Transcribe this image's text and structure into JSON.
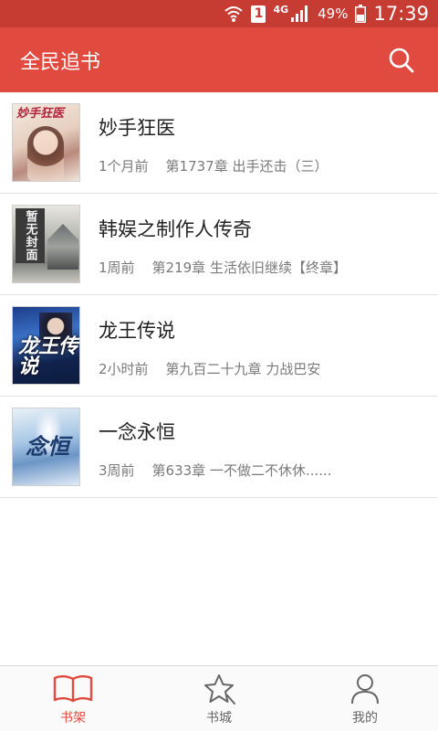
{
  "status_bar": {
    "network_type": "4G",
    "sim_label": "1",
    "battery": "49%",
    "time": "17:39",
    "icons": [
      "wifi-icon",
      "sim-icon",
      "signal-icon",
      "battery-icon"
    ]
  },
  "app_bar": {
    "title": "全民追书",
    "search_icon": "search-icon"
  },
  "books": [
    {
      "title": "妙手狂医",
      "time": "1个月前",
      "chapter": "第1737章 出手还击（三）",
      "cover_text": "妙手狂医"
    },
    {
      "title": "韩娱之制作人传奇",
      "time": "1周前",
      "chapter": "第219章 生活依旧继续【终章】",
      "cover_text": "暂无封面"
    },
    {
      "title": "龙王传说",
      "time": "2小时前",
      "chapter": "第九百二十九章 力战巴安",
      "cover_text": "龙王传说"
    },
    {
      "title": "一念永恒",
      "time": "3周前",
      "chapter": "第633章 一不做二不休休......",
      "cover_text": "念恒"
    }
  ],
  "bottom_nav": [
    {
      "label": "书架",
      "icon": "book-open-icon",
      "active": true
    },
    {
      "label": "书城",
      "icon": "star-icon",
      "active": false
    },
    {
      "label": "我的",
      "icon": "user-icon",
      "active": false
    }
  ],
  "colors": {
    "app_bar": "#e04a3f",
    "status_bar": "#c63b32",
    "active_tab": "#e04a3f"
  }
}
